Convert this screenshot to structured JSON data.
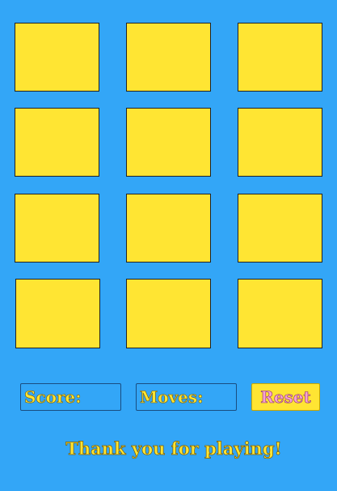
{
  "board": {
    "rows": 4,
    "columns": 3,
    "card_color": "#ffe533",
    "cards_face_down": 12
  },
  "stats": {
    "score_label": "Score:",
    "score_value": "",
    "moves_label": "Moves:",
    "moves_value": ""
  },
  "controls": {
    "reset_label": "Reset",
    "reset_color": "#f7a2d2"
  },
  "footer": {
    "message": "Thank you for playing!"
  },
  "colors": {
    "background": "#33a6f7",
    "accent_yellow": "#ffe533"
  }
}
